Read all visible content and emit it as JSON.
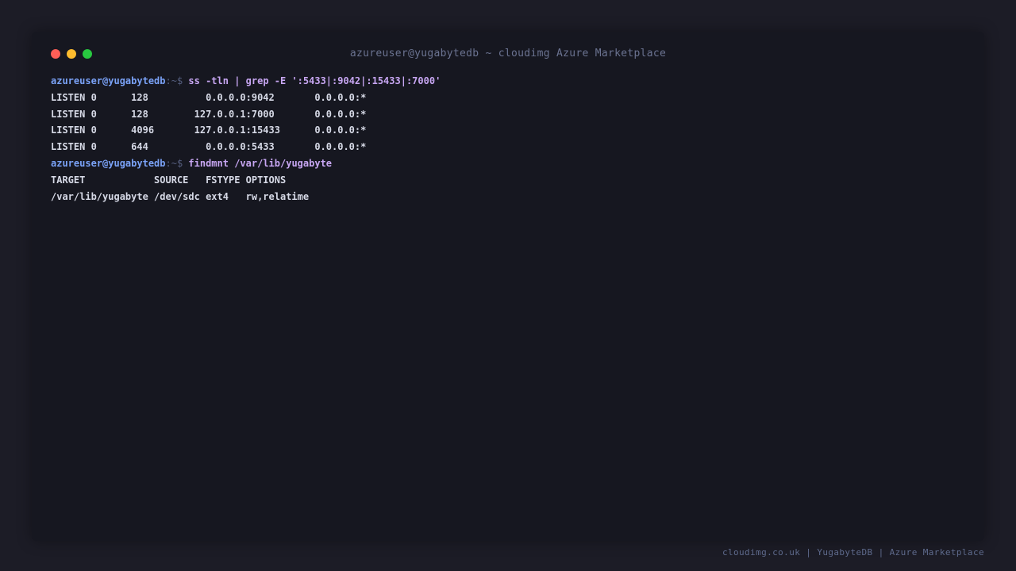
{
  "window": {
    "title": "azureuser@yugabytedb ~ cloudimg Azure Marketplace",
    "controls": {
      "close_color": "#ff5f57",
      "minimize_color": "#febc2e",
      "maximize_color": "#28c840"
    }
  },
  "terminal": {
    "prompt_user": "azureuser@yugabytedb",
    "prompt_suffix": ":~$",
    "lines": [
      {
        "type": "prompt",
        "command": "ss -tln | grep -E ':5433|:9042|:15433|:7000'"
      },
      {
        "type": "output",
        "text": "LISTEN 0      128          0.0.0.0:9042       0.0.0.0:*"
      },
      {
        "type": "output",
        "text": "LISTEN 0      128        127.0.0.1:7000       0.0.0.0:*"
      },
      {
        "type": "output",
        "text": "LISTEN 0      4096       127.0.0.1:15433      0.0.0.0:*"
      },
      {
        "type": "output",
        "text": "LISTEN 0      644          0.0.0.0:5433       0.0.0.0:*"
      },
      {
        "type": "prompt",
        "command": "findmnt /var/lib/yugabyte"
      },
      {
        "type": "output",
        "text": "TARGET            SOURCE   FSTYPE OPTIONS"
      },
      {
        "type": "output",
        "text": "/var/lib/yugabyte /dev/sdc ext4   rw,relatime"
      }
    ]
  },
  "footer": {
    "text": "cloudimg.co.uk | YugabyteDB | Azure Marketplace"
  },
  "colors": {
    "background": "#1c1c26",
    "window_bg": "#161720",
    "prompt_user": "#7aa2f7",
    "command": "#c7a6f2",
    "output": "#d6d9e6"
  }
}
